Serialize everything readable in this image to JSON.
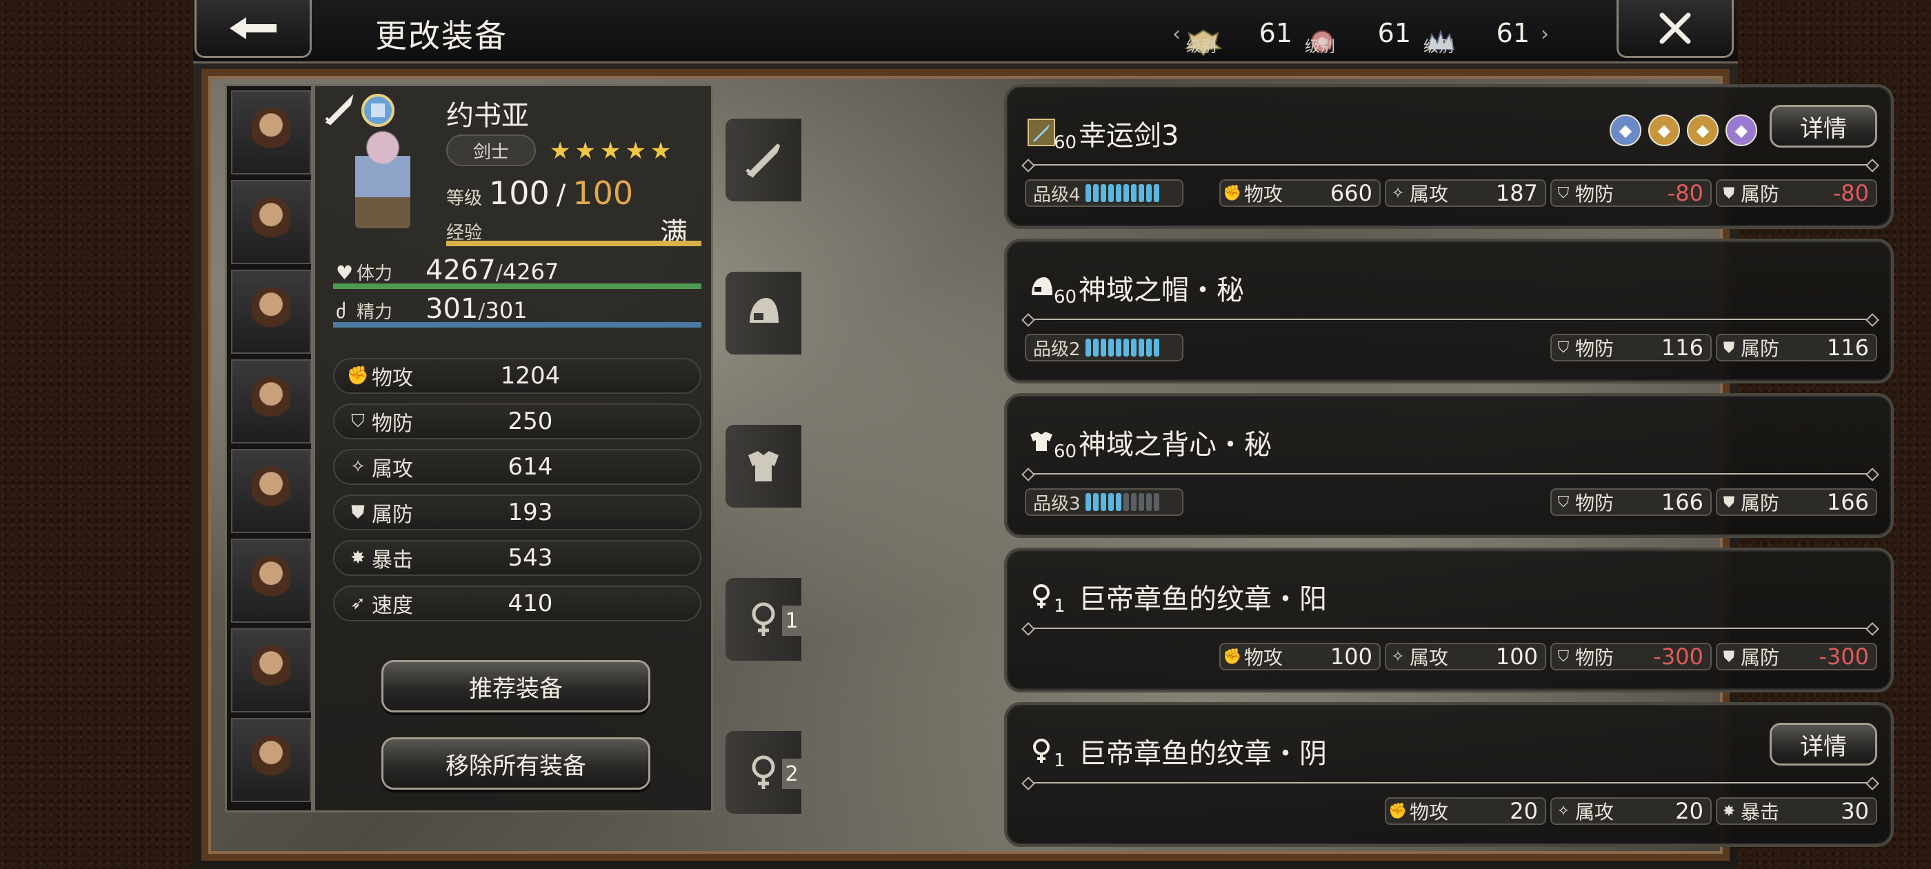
{
  "header": {
    "title": "更改装备",
    "levels": [
      {
        "label": "级别",
        "value": "61",
        "emblem": "gold-emblem-icon"
      },
      {
        "label": "级别",
        "value": "61",
        "emblem": "red-emblem-icon"
      },
      {
        "label": "级别",
        "value": "61",
        "emblem": "silver-emblem-icon"
      }
    ]
  },
  "character": {
    "name": "约书亚",
    "class": "剑士",
    "stars": "★★★★★",
    "level_label": "等级",
    "level": "100",
    "level_max": "100",
    "exp_label": "经验",
    "exp_value": "满",
    "hp_label": "体力",
    "hp": "4267",
    "hp_max": "4267",
    "sp_label": "精力",
    "sp": "301",
    "sp_max": "301",
    "stats": [
      {
        "name": "物攻",
        "value": "1204",
        "icon": "phys-atk-icon"
      },
      {
        "name": "物防",
        "value": "250",
        "icon": "phys-def-icon"
      },
      {
        "name": "属攻",
        "value": "614",
        "icon": "elem-atk-icon"
      },
      {
        "name": "属防",
        "value": "193",
        "icon": "elem-def-icon"
      },
      {
        "name": "暴击",
        "value": "543",
        "icon": "crit-icon"
      },
      {
        "name": "速度",
        "value": "410",
        "icon": "speed-icon"
      }
    ],
    "buttons": {
      "recommend": "推荐装备",
      "remove_all": "移除所有装备"
    }
  },
  "slots": [
    {
      "icon": "sword-icon",
      "num": ""
    },
    {
      "icon": "helmet-icon",
      "num": ""
    },
    {
      "icon": "armor-icon",
      "num": ""
    },
    {
      "icon": "accessory-icon",
      "num": "1"
    },
    {
      "icon": "accessory-icon",
      "num": "2"
    }
  ],
  "equipment": [
    {
      "name": "幸运剑3",
      "level": "60",
      "icon": "sword-icon",
      "grade_label": "品级4",
      "grade": 10,
      "grade_max": 10,
      "detail": "详情",
      "stats": [
        {
          "name": "物攻",
          "value": "660"
        },
        {
          "name": "属攻",
          "value": "187"
        },
        {
          "name": "物防",
          "value": "-80"
        },
        {
          "name": "属防",
          "value": "-80"
        }
      ]
    },
    {
      "name": "神域之帽・秘",
      "level": "60",
      "icon": "helmet-icon",
      "grade_label": "品级2",
      "grade": 10,
      "grade_max": 10,
      "stats": [
        {
          "name": "物防",
          "value": "116"
        },
        {
          "name": "属防",
          "value": "116"
        }
      ]
    },
    {
      "name": "神域之背心・秘",
      "level": "60",
      "icon": "armor-icon",
      "grade_label": "品级3",
      "grade": 5,
      "grade_max": 10,
      "stats": [
        {
          "name": "物防",
          "value": "166"
        },
        {
          "name": "属防",
          "value": "166"
        }
      ]
    },
    {
      "name": "巨帝章鱼的纹章・阳",
      "level": "1",
      "icon": "accessory-icon",
      "stats": [
        {
          "name": "物攻",
          "value": "100"
        },
        {
          "name": "属攻",
          "value": "100"
        },
        {
          "name": "物防",
          "value": "-300"
        },
        {
          "name": "属防",
          "value": "-300"
        }
      ]
    },
    {
      "name": "巨帝章鱼的纹章・阴",
      "level": "1",
      "icon": "accessory-icon",
      "detail": "详情",
      "stats": [
        {
          "name": "物攻",
          "value": "20"
        },
        {
          "name": "属攻",
          "value": "20"
        },
        {
          "name": "暴击",
          "value": "30"
        }
      ]
    }
  ],
  "colors": {
    "negative": "#e25a5a",
    "grade_pip": "#5bb7e0",
    "hp_bar": "#4f9a52",
    "sp_bar": "#4b79a3",
    "exp_bar": "#d8b14a",
    "level_max": "#e3a84a",
    "star": "#f0c644"
  }
}
